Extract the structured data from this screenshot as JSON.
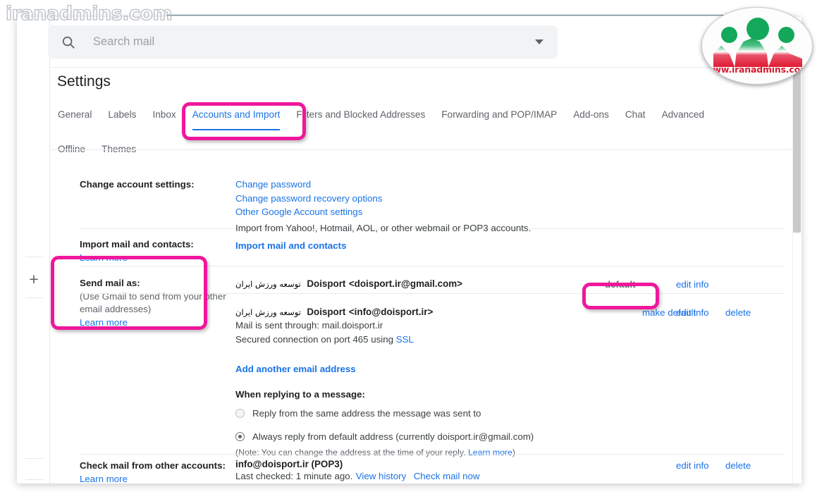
{
  "watermark": {
    "top_left_text": "iranadmins.com",
    "logo_url_text": "www.iranadmins.com",
    "accent_pink": "#f0179c"
  },
  "search": {
    "placeholder": "Search mail",
    "value": "",
    "icon": "search-icon",
    "dropdown_icon": "chevron-down-icon"
  },
  "rail": {
    "add_icon": "plus-icon"
  },
  "header": {
    "title": "Settings"
  },
  "tabs": [
    {
      "label": "General",
      "active": false
    },
    {
      "label": "Labels",
      "active": false
    },
    {
      "label": "Inbox",
      "active": false
    },
    {
      "label": "Accounts and Import",
      "active": true
    },
    {
      "label": "Filters and Blocked Addresses",
      "active": false
    },
    {
      "label": "Forwarding and POP/IMAP",
      "active": false
    },
    {
      "label": "Add-ons",
      "active": false
    },
    {
      "label": "Chat",
      "active": false
    },
    {
      "label": "Advanced",
      "active": false
    },
    {
      "label": "Offline",
      "active": false
    },
    {
      "label": "Themes",
      "active": false
    }
  ],
  "sections": {
    "change_account": {
      "label": "Change account settings:",
      "links": [
        "Change password",
        "Change password recovery options",
        "Other Google Account settings"
      ]
    },
    "import": {
      "label": "Import mail and contacts:",
      "learn_more": "Learn more",
      "note": "Import from Yahoo!, Hotmail, AOL, or other webmail or POP3 accounts.",
      "action": "Import mail and contacts"
    },
    "send_mail_as": {
      "label": "Send mail as:",
      "hint": "(Use Gmail to send from your other email addresses)",
      "learn_more": "Learn more",
      "accounts": [
        {
          "name_rtl": "توسعه ورزش ایران",
          "name": "Doisport",
          "address": "<doisport.ir@gmail.com>",
          "status": "default",
          "make_default": null,
          "edit": "edit info",
          "delete": null,
          "details": []
        },
        {
          "name_rtl": "توسعه ورزش ایران",
          "name": "Doisport",
          "address": "<info@doisport.ir>",
          "status": null,
          "make_default": "make default",
          "edit": "edit info",
          "delete": "delete",
          "details": [
            "Mail is sent through: mail.doisport.ir",
            "Secured connection on port 465 using "
          ],
          "ssl_link": "SSL"
        }
      ],
      "add_another": "Add another email address",
      "reply": {
        "heading": "When replying to a message:",
        "options": [
          {
            "label": "Reply from the same address the message was sent to",
            "selected": false
          },
          {
            "label": "Always reply from default address (currently doisport.ir@gmail.com)",
            "selected": true
          }
        ],
        "note_prefix": "(Note: You can change the address at the time of your reply. ",
        "note_link": "Learn more",
        "note_suffix": ")"
      }
    },
    "check_mail": {
      "label": "Check mail from other accounts:",
      "learn_more": "Learn more",
      "account": "info@doisport.ir (POP3)",
      "last_checked": "Last checked: 1 minute ago.",
      "view_history": "View history",
      "check_now": "Check mail now",
      "edit": "edit info",
      "delete": "delete"
    }
  },
  "scrollbar": {
    "name": "vertical-scrollbar"
  }
}
